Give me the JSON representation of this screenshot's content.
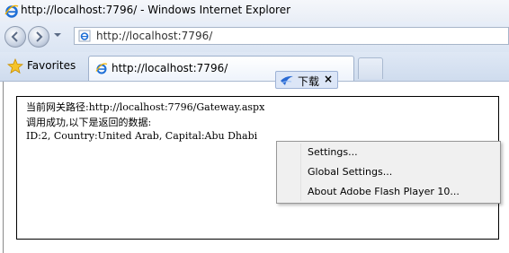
{
  "window": {
    "title": "http://localhost:7796/ - Windows Internet Explorer"
  },
  "address_bar": {
    "url": "http://localhost:7796/"
  },
  "favorites_bar": {
    "favorites_label": "Favorites"
  },
  "tabs": [
    {
      "title": "http://localhost:7796/"
    }
  ],
  "download_pill": {
    "label": "下载",
    "close": "×"
  },
  "page": {
    "lines": [
      "当前网关路径:http://localhost:7796/Gateway.aspx",
      "调用成功,以下是返回的数据:",
      "ID:2, Country:United Arab, Capital:Abu Dhabi"
    ]
  },
  "context_menu": {
    "items": [
      "Settings...",
      "Global Settings...",
      "About Adobe Flash Player 10..."
    ]
  },
  "colors": {
    "chrome_blue": "#dbe5f3",
    "menu_bg": "#f0f0f0"
  }
}
